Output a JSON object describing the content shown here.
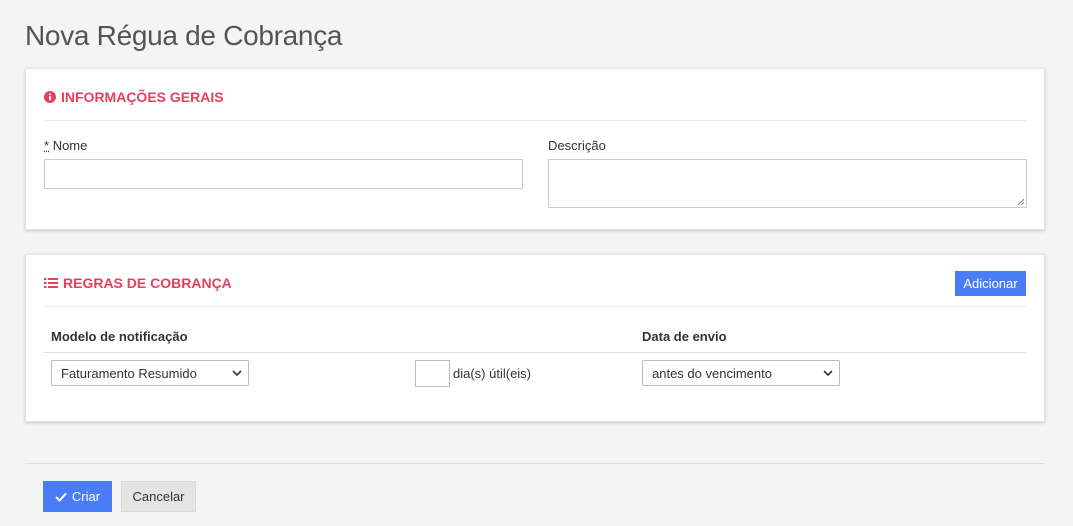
{
  "page": {
    "title": "Nova Régua de Cobrança"
  },
  "general": {
    "title": "INFORMAÇÕES GERAIS",
    "icon": "info-circle-icon",
    "name_required_mark": "*",
    "name_label": "Nome",
    "name_value": "",
    "description_label": "Descrição",
    "description_value": ""
  },
  "rules": {
    "title": "REGRAS DE COBRANÇA",
    "icon": "list-icon",
    "add_label": "Adicionar",
    "columns": [
      "Modelo de notificação",
      "Data de envio"
    ],
    "rows": [
      {
        "model": "Faturamento Resumido",
        "days": "",
        "days_suffix": "dia(s) útil(eis)",
        "send_date": "antes do vencimento"
      }
    ]
  },
  "footer": {
    "create_label": "Criar",
    "cancel_label": "Cancelar"
  },
  "colors": {
    "accent_red": "#e6405e",
    "primary_blue": "#4a7cf7"
  }
}
